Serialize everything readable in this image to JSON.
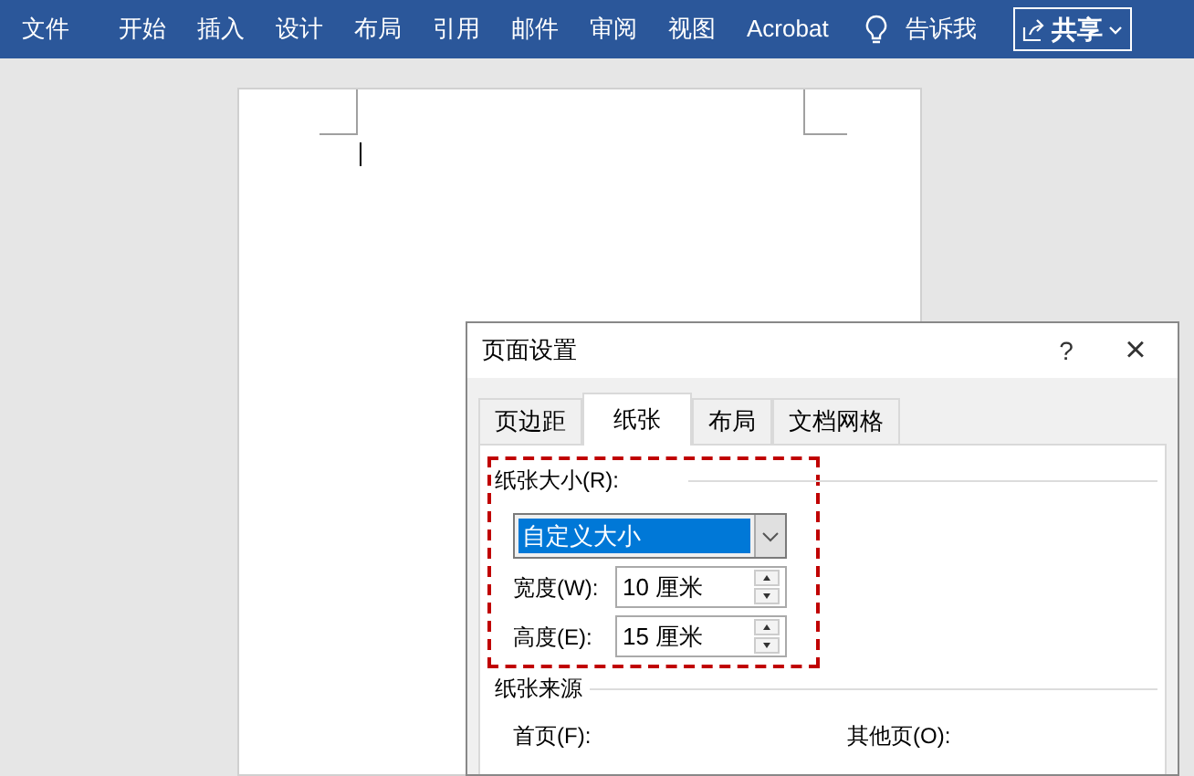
{
  "ribbon": {
    "tabs": [
      {
        "label": "文件"
      },
      {
        "label": "开始"
      },
      {
        "label": "插入"
      },
      {
        "label": "设计"
      },
      {
        "label": "布局"
      },
      {
        "label": "引用"
      },
      {
        "label": "邮件"
      },
      {
        "label": "审阅"
      },
      {
        "label": "视图"
      },
      {
        "label": "Acrobat"
      }
    ],
    "tell_me": "告诉我",
    "share": "共享"
  },
  "dialog": {
    "title": "页面设置",
    "help": "?",
    "close": "×",
    "tabs": [
      {
        "label": "页边距",
        "selected": false
      },
      {
        "label": "纸张",
        "selected": true
      },
      {
        "label": "布局",
        "selected": false
      },
      {
        "label": "文档网格",
        "selected": false
      }
    ],
    "paper_size": {
      "label": "纸张大小(R):",
      "value": "自定义大小",
      "width_label": "宽度(W):",
      "width": "10 厘米",
      "height_label": "高度(E):",
      "height": "15 厘米"
    },
    "paper_source": {
      "label": "纸张来源",
      "first_page": "首页(F):",
      "other_pages": "其他页(O):"
    }
  }
}
